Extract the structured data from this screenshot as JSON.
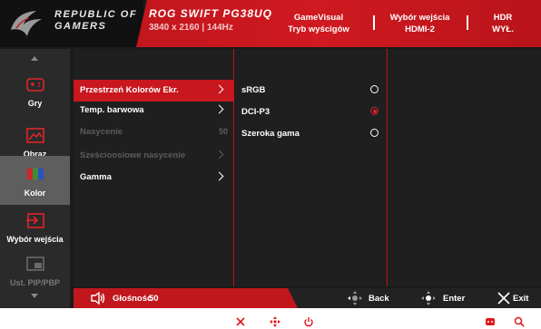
{
  "header": {
    "brand_line1": "REPUBLIC OF",
    "brand_line2": "GAMERS",
    "model": "ROG SWIFT PG38UQ",
    "resolution": "3840 x 2160 | 144Hz",
    "status": [
      {
        "line1": "GameVisual",
        "line2": "Tryb wyścigów"
      },
      {
        "line1": "Wybór wejścia",
        "line2": "HDMI-2"
      },
      {
        "line1": "HDR",
        "line2": "WYŁ."
      }
    ]
  },
  "sidebar": {
    "items": [
      {
        "label": "Gry",
        "icon": "gamepad-icon"
      },
      {
        "label": "Obraz",
        "icon": "picture-icon"
      },
      {
        "label": "Kolor",
        "icon": "color-icon",
        "active": true
      },
      {
        "label": "Wybór wejścia",
        "icon": "input-icon"
      },
      {
        "label": "Ust. PIP/PBP",
        "icon": "pip-icon",
        "disabled": true
      }
    ]
  },
  "menu": {
    "items": [
      {
        "label": "Przestrzeń Kolorów Ekr.",
        "active": true
      },
      {
        "label": "Temp. barwowa"
      },
      {
        "label": "Nasycenie",
        "value": "50",
        "disabled": true
      },
      {
        "label": "Sześcioosiowe nasycenie",
        "disabled": true
      },
      {
        "label": "Gamma"
      }
    ]
  },
  "options": {
    "items": [
      {
        "label": "sRGB",
        "selected": false
      },
      {
        "label": "DCI-P3",
        "selected": true
      },
      {
        "label": "Szeroka gama",
        "selected": false
      }
    ]
  },
  "footer": {
    "volume_label": "Głośność",
    "volume_value": "50",
    "back_label": "Back",
    "enter_label": "Enter",
    "exit_label": "Exit"
  },
  "colors": {
    "accent_red": "#c8171e",
    "selected_radio": "#e2232a",
    "bezel_button_red": "#e0161c"
  },
  "bezel_buttons": [
    "close-icon",
    "move-icon",
    "power-icon",
    "gamevisual-icon",
    "search-icon"
  ]
}
